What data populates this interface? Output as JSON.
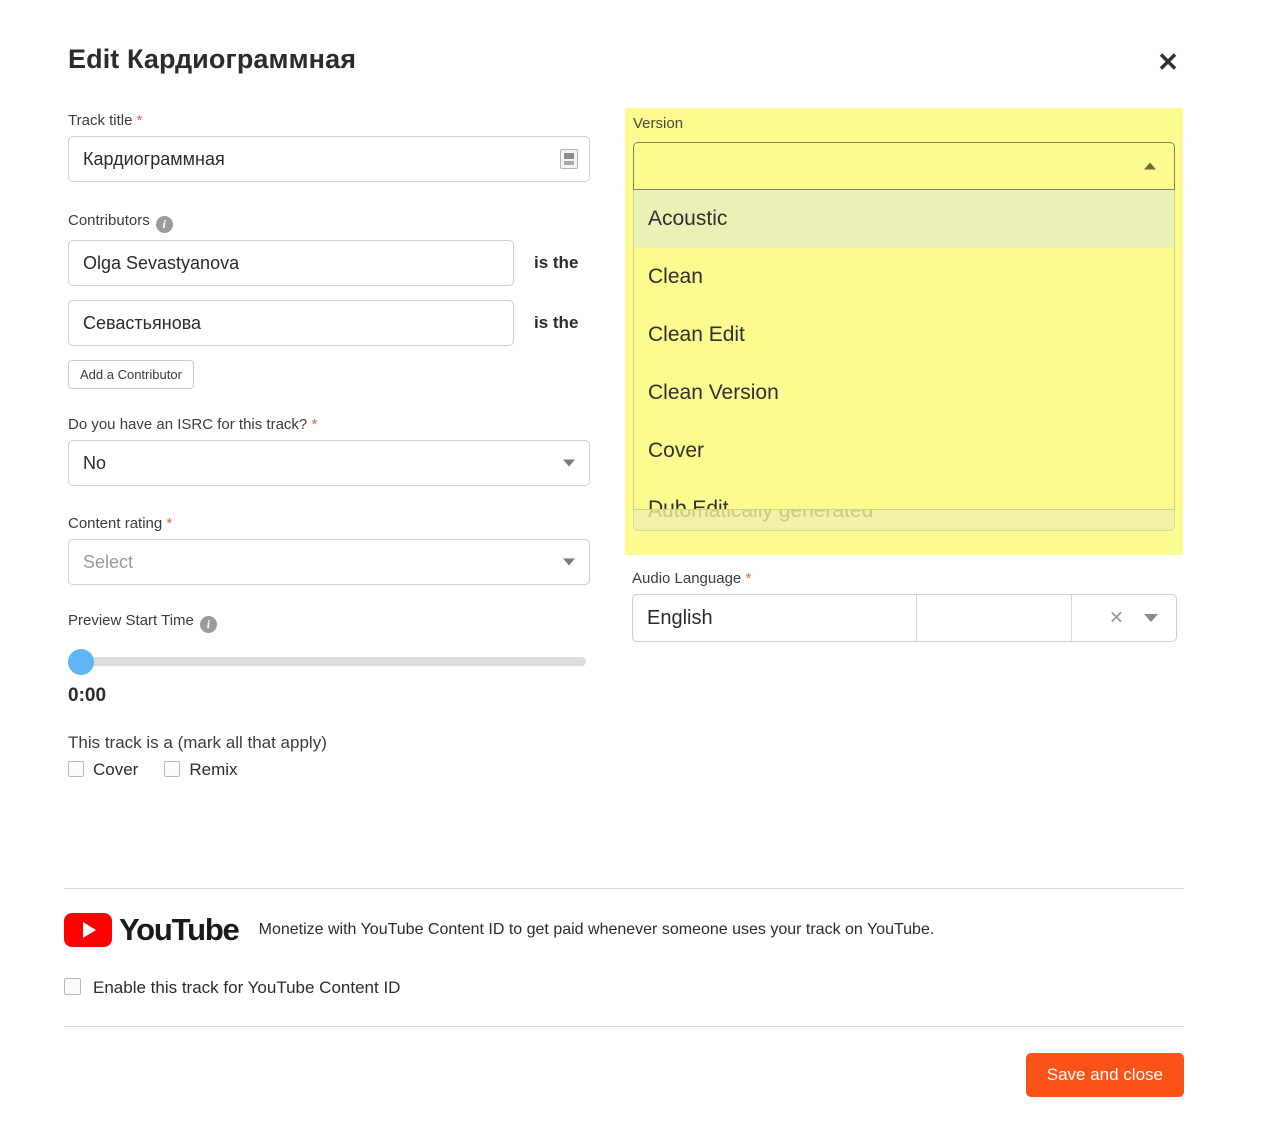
{
  "modal": {
    "title": "Edit Кардиограммная",
    "close_label": "✕"
  },
  "track_title": {
    "label": "Track title",
    "required_marker": "*",
    "value": "Кардиограммная",
    "placeholder": "Track title",
    "badge_icon": "id-card-icon"
  },
  "contributors": {
    "label": "Contributors",
    "info_icon": "i",
    "rows": [
      {
        "value": "Olga Sevastyanova",
        "suffix": "is the"
      },
      {
        "value": "Севастьянова",
        "suffix": "is the"
      }
    ],
    "add_label": "Add a Contributor"
  },
  "isrc": {
    "label": "Do you have an ISRC for this track?",
    "required_marker": "*",
    "value": "No"
  },
  "content_rating": {
    "label": "Content rating",
    "required_marker": "*",
    "value": "Select",
    "is_placeholder": true
  },
  "preview_start": {
    "label": "Preview Start Time",
    "info_icon": "i",
    "value": "0:00",
    "position_percent": 0
  },
  "track_is_a": {
    "label": "This track is a (mark all that apply)",
    "options": [
      {
        "label": "Cover",
        "checked": false
      },
      {
        "label": "Remix",
        "checked": false
      }
    ]
  },
  "version": {
    "label": "Version",
    "value": "",
    "expanded": true,
    "highlight_color": "#fbfb8f",
    "hover_color": "#ebf0b7",
    "options": [
      "Acoustic",
      "Clean",
      "Clean Edit",
      "Clean Version",
      "Cover",
      "Dub Edit"
    ],
    "hovered_index": 0
  },
  "obscured_field": {
    "ghost_text": "Automatically generated"
  },
  "audio_language": {
    "label": "Audio Language",
    "required_marker": "*",
    "value": "English",
    "clear_icon": "✕"
  },
  "youtube": {
    "logo_text": "YouTube",
    "description": "Monetize with YouTube Content ID to get paid whenever someone uses your track on YouTube.",
    "checkbox_label": "Enable this track for YouTube Content ID",
    "checkbox_checked": false,
    "brand_color": "#ff0000"
  },
  "footer": {
    "save_label": "Save and close",
    "save_color": "#fb5218"
  }
}
